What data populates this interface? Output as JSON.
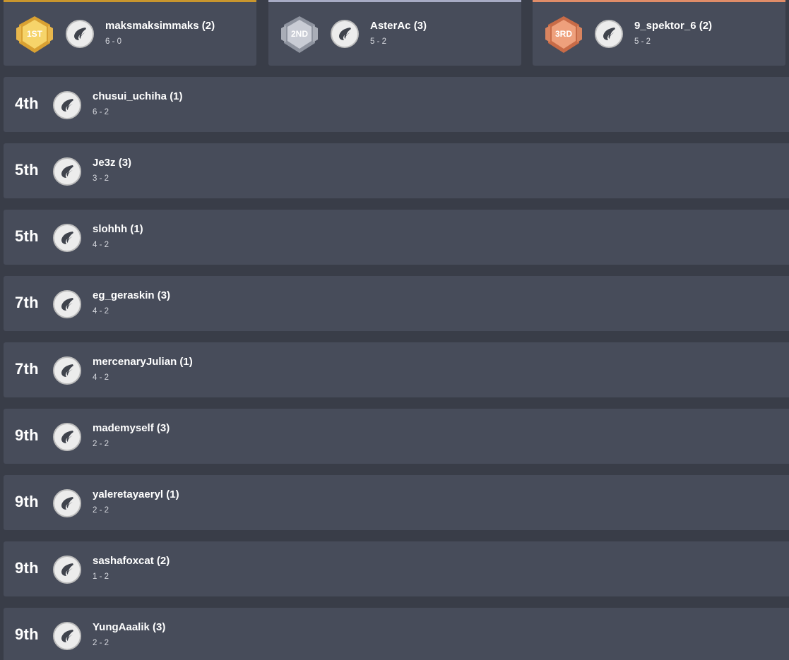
{
  "podium": [
    {
      "medal_label": "1ST",
      "name": "maksmaksimmaks (2)",
      "record": "6 - 0",
      "accent": "#c9962e",
      "medal_light": "#f6d46a",
      "medal_dark": "#d9a132",
      "medal_icon": "gold-medal-icon"
    },
    {
      "medal_label": "2ND",
      "name": "AsterAc (3)",
      "record": "5 - 2",
      "accent": "#a7abc4",
      "medal_light": "#c9ccd5",
      "medal_dark": "#8e939f",
      "medal_icon": "silver-medal-icon"
    },
    {
      "medal_label": "3RD",
      "name": "9_spektor_6 (2)",
      "record": "5 - 2",
      "accent": "#e08c68",
      "medal_light": "#eea07c",
      "medal_dark": "#c86b47",
      "medal_icon": "bronze-medal-icon"
    }
  ],
  "rows": [
    {
      "rank": "4th",
      "name": "chusui_uchiha (1)",
      "record": "6 - 2"
    },
    {
      "rank": "5th",
      "name": "Je3z (3)",
      "record": "3 - 2"
    },
    {
      "rank": "5th",
      "name": "slohhh (1)",
      "record": "4 - 2"
    },
    {
      "rank": "7th",
      "name": "eg_geraskin (3)",
      "record": "4 - 2"
    },
    {
      "rank": "7th",
      "name": "mercenaryJulian (1)",
      "record": "4 - 2"
    },
    {
      "rank": "9th",
      "name": "mademyself (3)",
      "record": "2 - 2"
    },
    {
      "rank": "9th",
      "name": "yaleretayaeryl (1)",
      "record": "2 - 2"
    },
    {
      "rank": "9th",
      "name": "sashafoxcat (2)",
      "record": "1 - 2"
    },
    {
      "rank": "9th",
      "name": "YungAaalik (3)",
      "record": "2 - 2"
    }
  ],
  "avatar_icon": "wing-logo-icon"
}
